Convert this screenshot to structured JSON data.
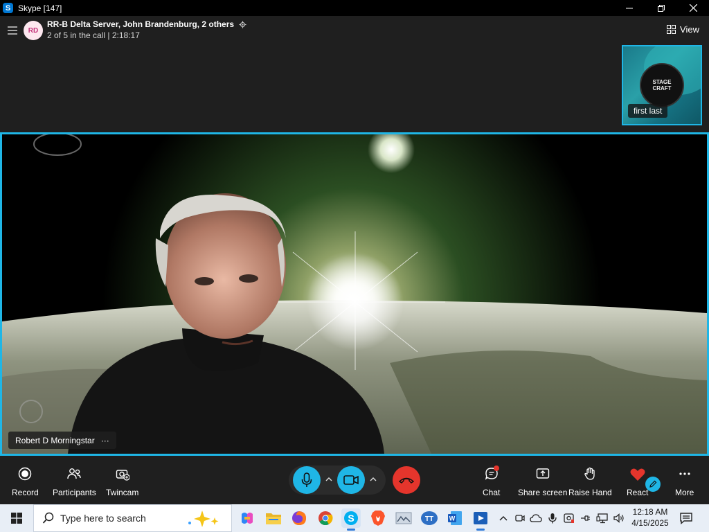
{
  "window": {
    "app_title": "Skype [147]",
    "logo_letter": "S"
  },
  "call": {
    "avatar_initials": "RD",
    "title": "RR-B Delta Server, John Brandenburg, 2 others",
    "subtitle": "2 of 5 in the call | 2:18:17",
    "view_label": "View",
    "self_tile_name": "first last",
    "speaker_name": "Robert D Morningstar",
    "speaker_menu": "···"
  },
  "controls": {
    "record": "Record",
    "participants": "Participants",
    "twincam": "Twincam",
    "chat": "Chat",
    "share_screen": "Share screen",
    "raise_hand": "Raise Hand",
    "react": "React",
    "more": "More"
  },
  "taskbar": {
    "search_placeholder": "Type here to search",
    "time": "12:18 AM",
    "date": "4/15/2025",
    "apps": [
      "copilot-icon",
      "file-explorer-icon",
      "firefox-icon",
      "chrome-icon",
      "skype-icon",
      "brave-icon",
      "photos-icon",
      "app-icon",
      "word-icon",
      "media-player-icon"
    ]
  },
  "colors": {
    "accent": "#1fb6e6",
    "hangup": "#e5352c",
    "background": "#1f1f1f"
  }
}
